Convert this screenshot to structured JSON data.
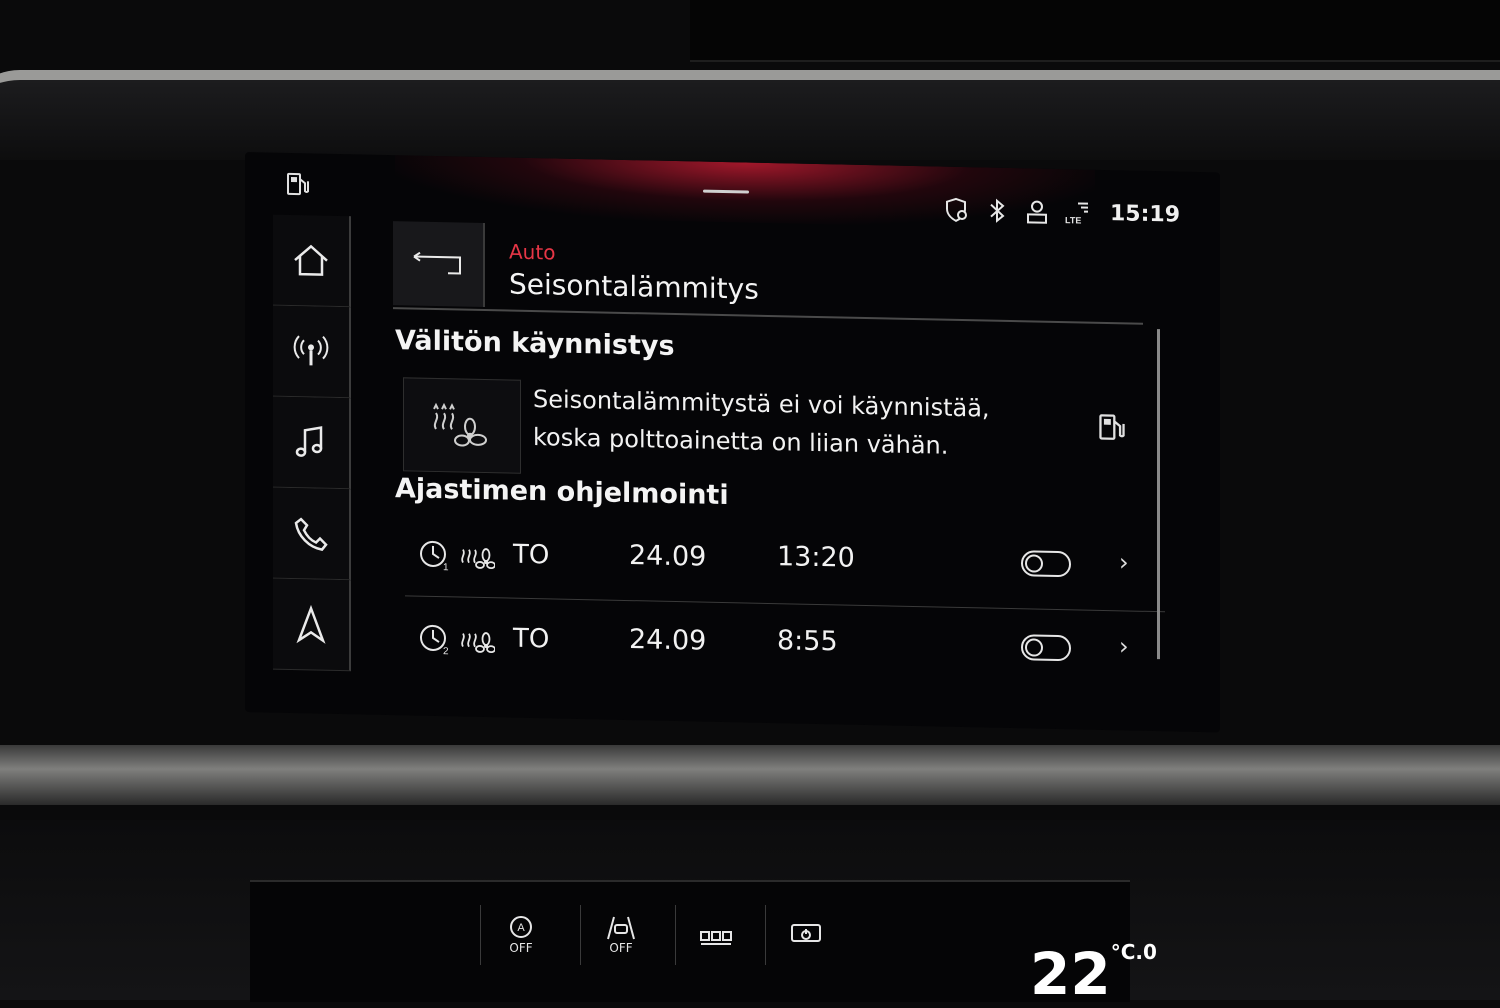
{
  "status_bar": {
    "icons": [
      "location-shield-icon",
      "bluetooth-icon",
      "user-icon",
      "lte-signal-icon"
    ],
    "lte_label": "LTE",
    "clock": "15:19"
  },
  "sidebar": {
    "items": [
      {
        "icon": "home-icon"
      },
      {
        "icon": "antenna-icon"
      },
      {
        "icon": "music-note-icon"
      },
      {
        "icon": "phone-icon"
      },
      {
        "icon": "navigation-icon"
      }
    ]
  },
  "header": {
    "breadcrumb": "Auto",
    "title": "Seisontalämmitys"
  },
  "immediate": {
    "heading": "Välitön käynnistys",
    "message_line1": "Seisontalämmitystä ei voi käynnistää,",
    "message_line2": "koska polttoainetta on liian vähän."
  },
  "timers": {
    "heading": "Ajastimen ohjelmointi",
    "rows": [
      {
        "timer_number": "1",
        "day": "TO",
        "date": "24.09",
        "time": "13:20",
        "enabled": false
      },
      {
        "timer_number": "2",
        "day": "TO",
        "date": "24.09",
        "time": "8:55",
        "enabled": false
      }
    ]
  },
  "climate_bar": {
    "buttons": [
      {
        "label": "OFF",
        "icon": "auto-hold-icon"
      },
      {
        "label": "OFF",
        "icon": "lane-assist-icon"
      },
      {
        "label": "",
        "icon": "seat-heating-icon"
      },
      {
        "label": "",
        "icon": "screen-power-icon"
      }
    ],
    "temperature": "22",
    "temperature_decimal": ".0",
    "temperature_unit": "°C"
  },
  "colors": {
    "accent": "#e63646",
    "background": "#050507",
    "text": "#f2f2f2"
  }
}
